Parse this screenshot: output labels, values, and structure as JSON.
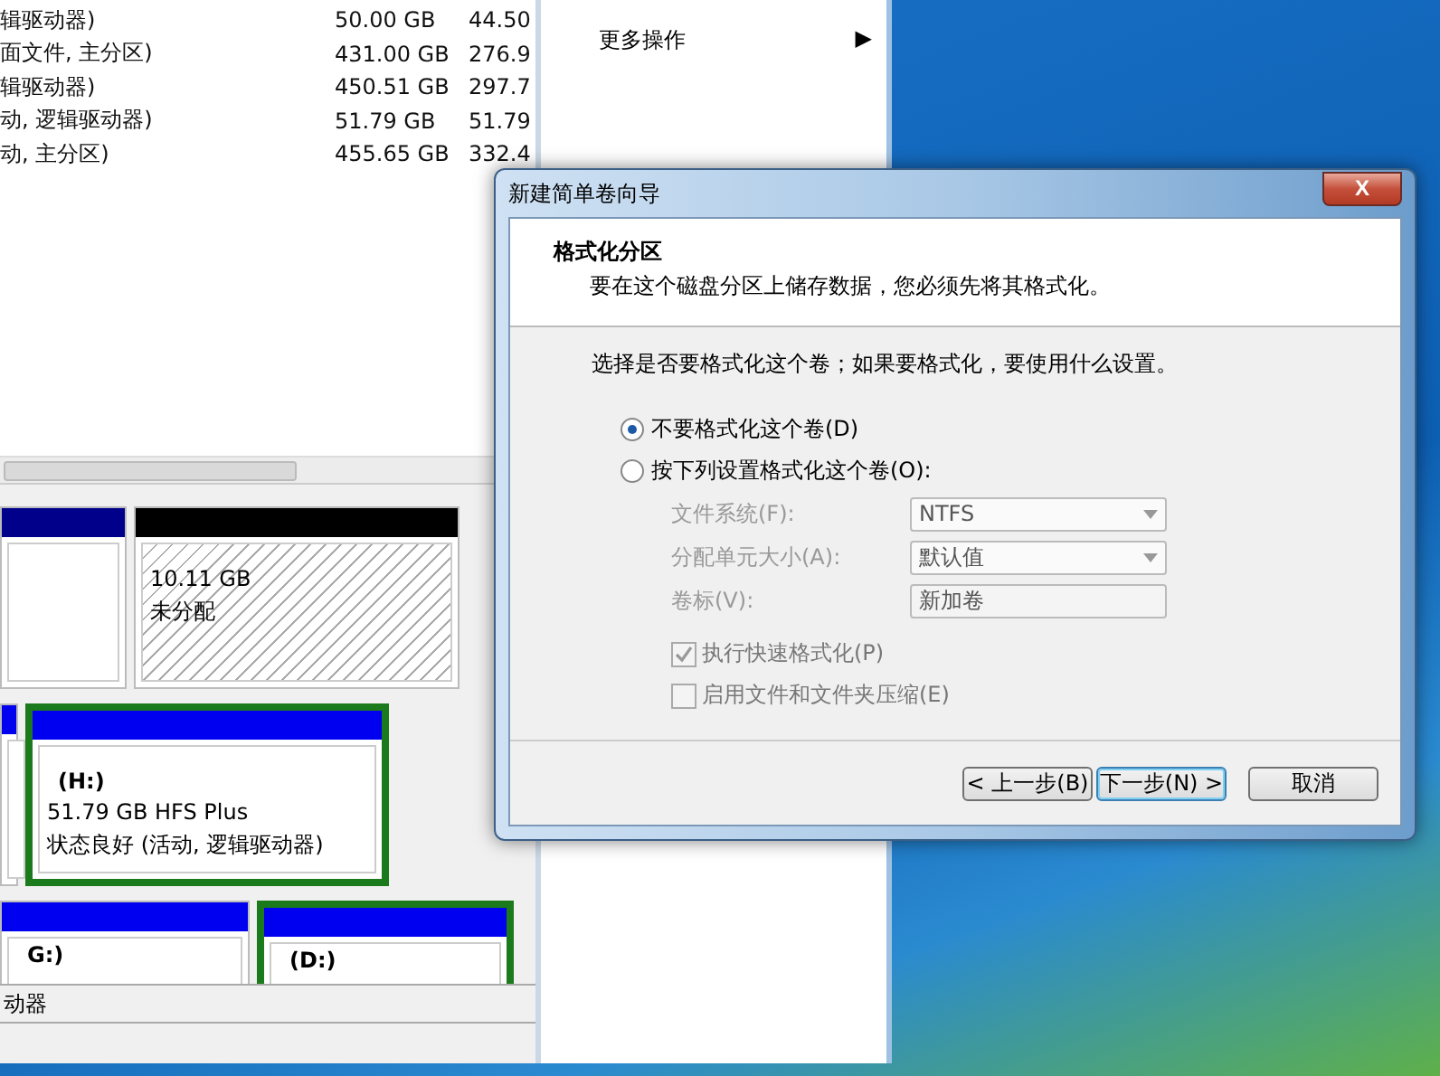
{
  "volume_list": {
    "rows": [
      {
        "column_1": "辑驱动器)",
        "capacity": "50.00 GB",
        "column_3": "44.50"
      },
      {
        "column_1": "面文件, 主分区)",
        "capacity": "431.00 GB",
        "column_3": "276.9"
      },
      {
        "column_1": "辑驱动器)",
        "capacity": "450.51 GB",
        "column_3": "297.7"
      },
      {
        "column_1": "动, 逻辑驱动器)",
        "capacity": "51.79 GB",
        "column_3": "51.79"
      },
      {
        "column_1": "动, 主分区)",
        "capacity": "455.65 GB",
        "column_3": "332.4"
      }
    ]
  },
  "actions_pane": {
    "items": [
      {
        "label": "更多操作",
        "arrow": "▶"
      }
    ]
  },
  "disk_map": {
    "rows": [
      {
        "partitions": [
          {
            "kind": "primary",
            "selected": false
          },
          {
            "kind": "unallocated",
            "selected": false,
            "lines": [
              "10.11 GB",
              "未分配"
            ]
          }
        ]
      },
      {
        "partitions": [
          {
            "kind": "logical",
            "selected": false
          },
          {
            "kind": "logical",
            "selected": true,
            "name": "(H:)",
            "lines": [
              "51.79 GB HFS Plus",
              "状态良好 (活动, 逻辑驱动器)"
            ]
          }
        ]
      },
      {
        "partitions": [
          {
            "kind": "logical",
            "selected": false,
            "name": "G:)"
          },
          {
            "kind": "logical",
            "selected": true,
            "name": "(D:)"
          }
        ]
      }
    ],
    "legend": "动器"
  },
  "dialog": {
    "title": "新建简单卷向导",
    "close": "X",
    "heading": "格式化分区",
    "subheading": "要在这个磁盘分区上储存数据，您必须先将其格式化。",
    "prompt": "选择是否要格式化这个卷；如果要格式化，要使用什么设置。",
    "options": [
      {
        "label": "不要格式化这个卷(D)",
        "selected": true
      },
      {
        "label": "按下列设置格式化这个卷(O):",
        "selected": false
      }
    ],
    "fields": [
      {
        "label": "文件系统(F):",
        "value": "NTFS",
        "kind": "dropdown",
        "disabled": true
      },
      {
        "label": "分配单元大小(A):",
        "value": "默认值",
        "kind": "dropdown",
        "disabled": true
      },
      {
        "label": "卷标(V):",
        "value": "新加卷",
        "kind": "text",
        "disabled": true
      }
    ],
    "checkboxes": [
      {
        "label": "执行快速格式化(P)",
        "checked": true,
        "disabled": true
      },
      {
        "label": "启用文件和文件夹压缩(E)",
        "checked": false,
        "disabled": true
      }
    ],
    "buttons": [
      {
        "label": "< 上一步(B)",
        "focused": false
      },
      {
        "label": "下一步(N) >",
        "focused": true
      },
      {
        "label": "取消",
        "focused": false
      }
    ]
  }
}
